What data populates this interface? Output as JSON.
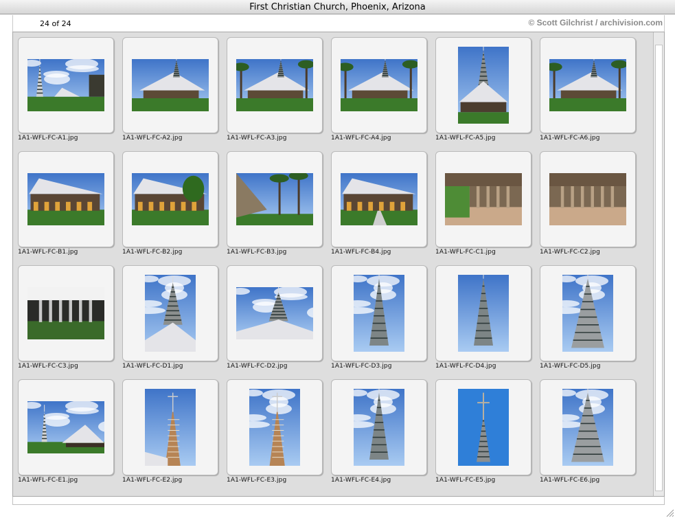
{
  "window": {
    "title": "First Christian Church, Phoenix, Arizona"
  },
  "info": {
    "count": "24 of 24",
    "credit": "© Scott Gilchrist / archivision.com"
  },
  "slides": [
    {
      "file": "1A1-WFL-FC-A1.jpg",
      "orientation": "landscape",
      "scene": "campus-distant"
    },
    {
      "file": "1A1-WFL-FC-A2.jpg",
      "orientation": "landscape",
      "scene": "roof-spire"
    },
    {
      "file": "1A1-WFL-FC-A3.jpg",
      "orientation": "landscape",
      "scene": "roof-spire-trees"
    },
    {
      "file": "1A1-WFL-FC-A4.jpg",
      "orientation": "landscape",
      "scene": "roof-palms"
    },
    {
      "file": "1A1-WFL-FC-A5.jpg",
      "orientation": "portrait",
      "scene": "roof-spire-tall"
    },
    {
      "file": "1A1-WFL-FC-A6.jpg",
      "orientation": "landscape",
      "scene": "roof-stepped"
    },
    {
      "file": "1A1-WFL-FC-B1.jpg",
      "orientation": "landscape",
      "scene": "building-front"
    },
    {
      "file": "1A1-WFL-FC-B2.jpg",
      "orientation": "landscape",
      "scene": "building-tree"
    },
    {
      "file": "1A1-WFL-FC-B3.jpg",
      "orientation": "landscape",
      "scene": "wall-palms"
    },
    {
      "file": "1A1-WFL-FC-B4.jpg",
      "orientation": "landscape",
      "scene": "building-path"
    },
    {
      "file": "1A1-WFL-FC-C1.jpg",
      "orientation": "landscape",
      "scene": "colonnade-light"
    },
    {
      "file": "1A1-WFL-FC-C2.jpg",
      "orientation": "landscape",
      "scene": "colonnade"
    },
    {
      "file": "1A1-WFL-FC-C3.jpg",
      "orientation": "landscape",
      "scene": "colonnade-dark"
    },
    {
      "file": "1A1-WFL-FC-D1.jpg",
      "orientation": "portrait",
      "scene": "spire-roof"
    },
    {
      "file": "1A1-WFL-FC-D2.jpg",
      "orientation": "landscape",
      "scene": "spire-roof-wide"
    },
    {
      "file": "1A1-WFL-FC-D3.jpg",
      "orientation": "portrait",
      "scene": "spire-clouds"
    },
    {
      "file": "1A1-WFL-FC-D4.jpg",
      "orientation": "portrait",
      "scene": "spire-blue"
    },
    {
      "file": "1A1-WFL-FC-D5.jpg",
      "orientation": "portrait",
      "scene": "spire-close"
    },
    {
      "file": "1A1-WFL-FC-E1.jpg",
      "orientation": "landscape",
      "scene": "campus-clouds"
    },
    {
      "file": "1A1-WFL-FC-E2.jpg",
      "orientation": "portrait",
      "scene": "bell-tower"
    },
    {
      "file": "1A1-WFL-FC-E3.jpg",
      "orientation": "portrait",
      "scene": "bell-tower-clouds"
    },
    {
      "file": "1A1-WFL-FC-E4.jpg",
      "orientation": "portrait",
      "scene": "spire-clouds"
    },
    {
      "file": "1A1-WFL-FC-E5.jpg",
      "orientation": "portrait",
      "scene": "cross-spire"
    },
    {
      "file": "1A1-WFL-FC-E6.jpg",
      "orientation": "portrait",
      "scene": "spire-close"
    }
  ]
}
